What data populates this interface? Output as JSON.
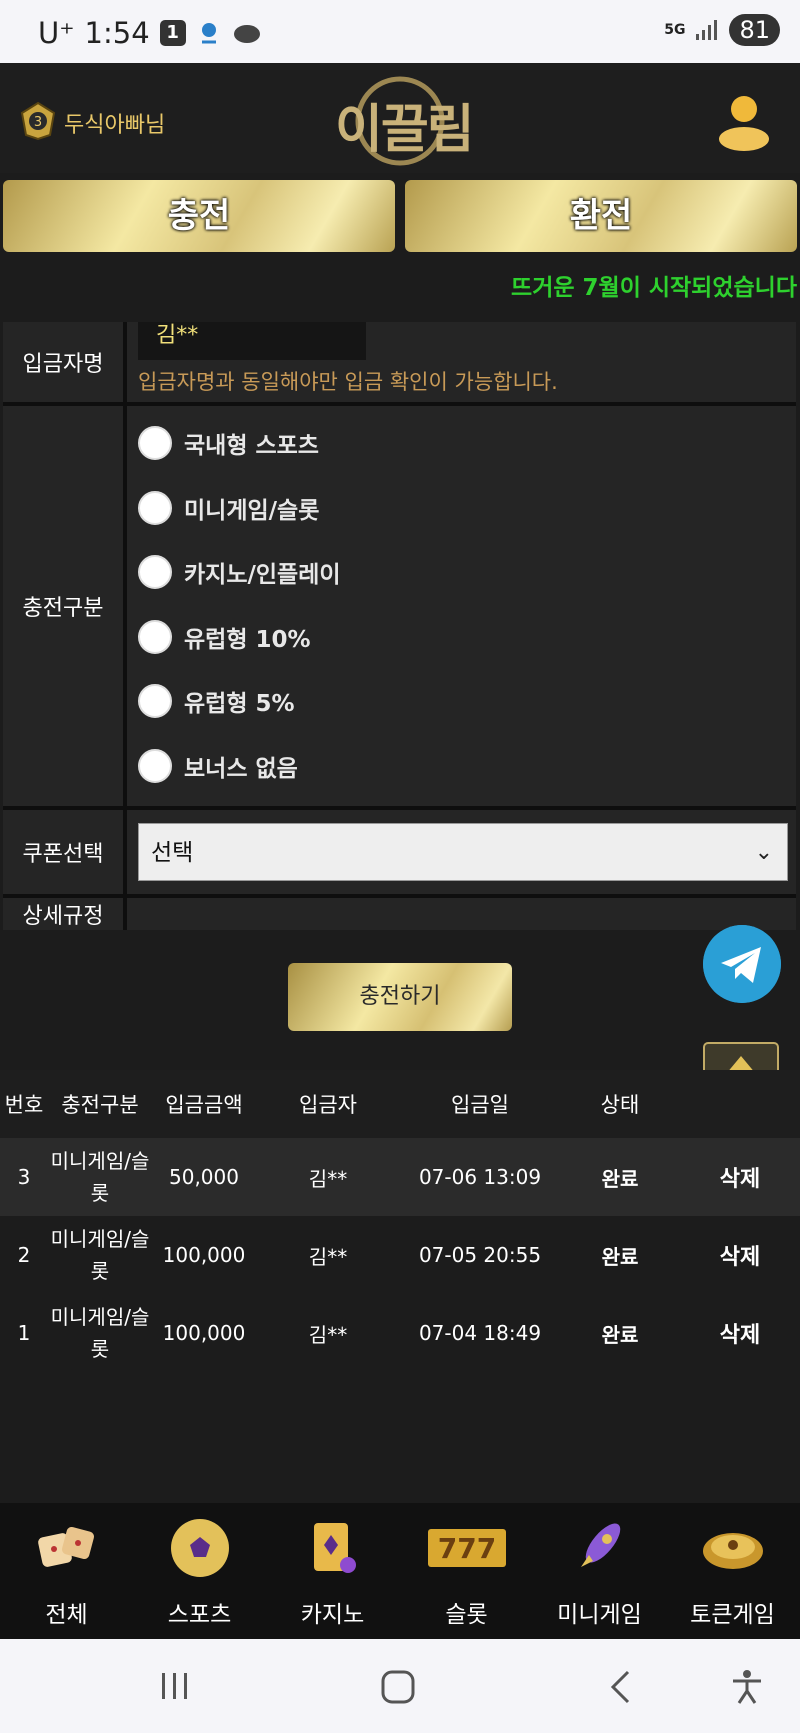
{
  "status_bar": {
    "carrier": "U⁺",
    "time": "1:54",
    "notif_badge": "1",
    "network": "5G",
    "battery": "81"
  },
  "header": {
    "username": "두식아빠님",
    "logo_text": "이끌림"
  },
  "tabs": {
    "charge": "충전",
    "exchange": "환전"
  },
  "notice": "뜨거운 7월이 시작되었습니다",
  "form": {
    "depositor_label": "입금자명",
    "depositor_value": "김**",
    "depositor_help": "입금자명과 동일해야만 입금 확인이 가능합니다.",
    "charge_type_label": "충전구분",
    "charge_types": [
      "국내형 스포츠",
      "미니게임/슬롯",
      "카지노/인플레이",
      "유럽형 10%",
      "유럽형 5%",
      "보너스 없음"
    ],
    "coupon_label": "쿠폰선택",
    "coupon_selected": "선택",
    "rules_label": "상세규정"
  },
  "submit_button": "충전하기",
  "table": {
    "headers": [
      "번호",
      "충전구분",
      "입금금액",
      "입금자",
      "입금일",
      "상태",
      ""
    ],
    "rows": [
      {
        "no": "3",
        "type": "미니게임/슬롯",
        "amount": "50,000",
        "depositor": "김**",
        "date": "07-06 13:09",
        "status": "완료",
        "action": "삭제"
      },
      {
        "no": "2",
        "type": "미니게임/슬롯",
        "amount": "100,000",
        "depositor": "김**",
        "date": "07-05 20:55",
        "status": "완료",
        "action": "삭제"
      },
      {
        "no": "1",
        "type": "미니게임/슬롯",
        "amount": "100,000",
        "depositor": "김**",
        "date": "07-04 18:49",
        "status": "완료",
        "action": "삭제"
      }
    ]
  },
  "bottom_nav": [
    {
      "label": "전체",
      "icon": "dice-icon"
    },
    {
      "label": "스포츠",
      "icon": "soccer-ball-icon"
    },
    {
      "label": "카지노",
      "icon": "cards-icon"
    },
    {
      "label": "슬롯",
      "icon": "slot-777-icon"
    },
    {
      "label": "미니게임",
      "icon": "rocket-icon"
    },
    {
      "label": "토큰게임",
      "icon": "roulette-icon"
    }
  ],
  "colors": {
    "gold": "#e9c869",
    "notice_green": "#2ed12e",
    "help_text": "#c89a57",
    "telegram": "#2a9fd6"
  }
}
